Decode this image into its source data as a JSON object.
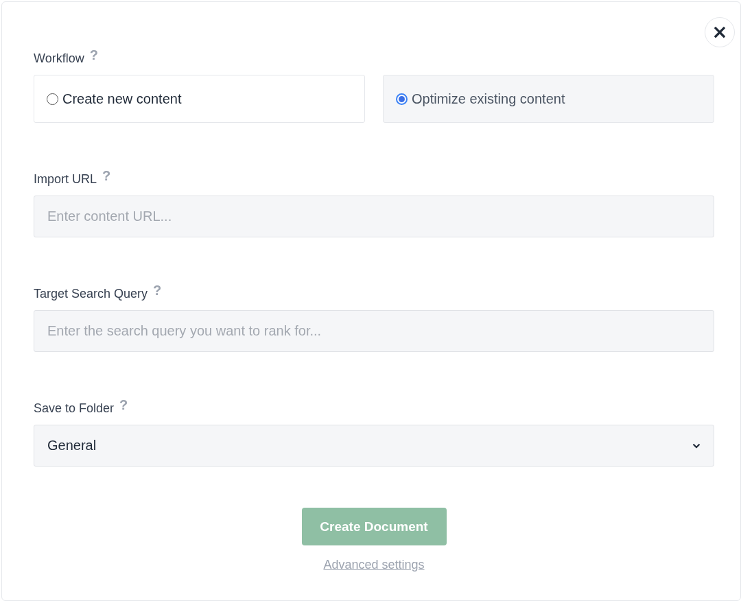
{
  "close_button": {
    "label": "×"
  },
  "workflow": {
    "label": "Workflow",
    "help": "?",
    "options": [
      {
        "label": "Create new content",
        "selected": false
      },
      {
        "label": "Optimize existing content",
        "selected": true
      }
    ]
  },
  "fields": [
    {
      "kind": "input",
      "label": "Import URL",
      "help": "?",
      "placeholder": "Enter content URL..."
    },
    {
      "kind": "input",
      "label": "Target Search Query",
      "help": "?",
      "placeholder": "Enter the search query you want to rank for..."
    },
    {
      "kind": "select",
      "label": "Save to Folder",
      "help": "?",
      "value": "General"
    }
  ],
  "submit": {
    "label": "Create Document",
    "disabled": true
  },
  "link": {
    "label": "Advanced settings"
  }
}
